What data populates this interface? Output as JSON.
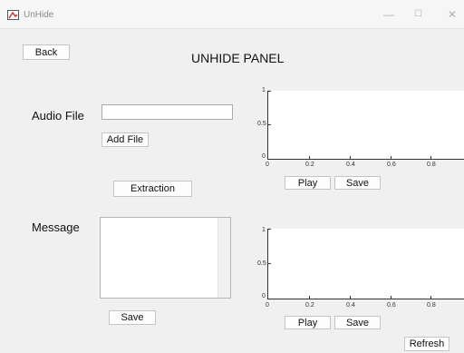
{
  "window": {
    "title": "UnHide",
    "minimize": "—",
    "maximize": "☐",
    "close": "✕",
    "accent_color": "#c0392b"
  },
  "header": {
    "back_label": "Back",
    "panel_title": "UNHIDE PANEL"
  },
  "audio": {
    "label": "Audio File",
    "file_value": "",
    "add_file_label": "Add File"
  },
  "extraction_label": "Extraction",
  "message": {
    "label": "Message",
    "text": "",
    "save_label": "Save"
  },
  "plot1": {
    "yticks": [
      "1",
      "0.5",
      "0"
    ],
    "xticks": [
      "0",
      "0.2",
      "0.4",
      "0.6",
      "0.8"
    ],
    "play_label": "Play",
    "save_label": "Save"
  },
  "plot2": {
    "yticks": [
      "1",
      "0.5",
      "0"
    ],
    "xticks": [
      "0",
      "0.2",
      "0.4",
      "0.6",
      "0.8"
    ],
    "play_label": "Play",
    "save_label": "Save"
  },
  "refresh_label": "Refresh"
}
